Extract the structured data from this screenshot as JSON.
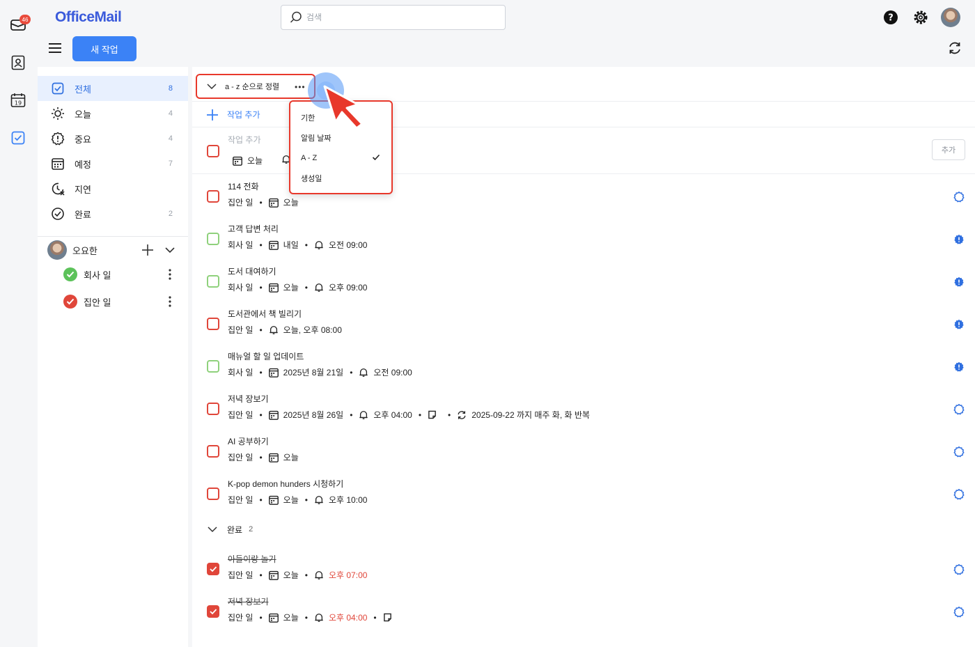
{
  "app": {
    "logo": "OfficeMail",
    "mail_badge": "46"
  },
  "search": {
    "placeholder": "검색"
  },
  "toolbar": {
    "new_task": "새 작업"
  },
  "sidebar": {
    "items": [
      {
        "label": "전체",
        "count": "8",
        "icon": "check-square-icon"
      },
      {
        "label": "오늘",
        "count": "4",
        "icon": "sun-icon"
      },
      {
        "label": "중요",
        "count": "4",
        "icon": "important-icon"
      },
      {
        "label": "예정",
        "count": "7",
        "icon": "calendar-icon"
      },
      {
        "label": "지연",
        "count": "",
        "icon": "overdue-clock-icon"
      },
      {
        "label": "완료",
        "count": "2",
        "icon": "check-circle-icon"
      }
    ],
    "group": {
      "name": "오요한"
    },
    "lists": [
      {
        "label": "회사 일",
        "color": "#5cc25a"
      },
      {
        "label": "집안 일",
        "color": "#e0463a"
      }
    ]
  },
  "sort": {
    "label": "a - z 순으로 정렬"
  },
  "sort_menu": {
    "items": [
      "기한",
      "알림 날짜",
      "A - Z",
      "생성일"
    ],
    "selected": "A - Z"
  },
  "add_task": {
    "label": "작업 추가"
  },
  "compose": {
    "placeholder": "작업 추가",
    "due": "오늘",
    "add_button": "추가"
  },
  "tasks": [
    {
      "title": "114 전화",
      "list": "집안 일",
      "due": "오늘",
      "remind": "",
      "extra": "",
      "color": "red",
      "star": "outline"
    },
    {
      "title": "고객 답변 처리",
      "list": "회사 일",
      "due": "내일",
      "remind": "오전 09:00",
      "extra": "",
      "color": "green",
      "star": "filled"
    },
    {
      "title": "도서 대여하기",
      "list": "회사 일",
      "due": "오늘",
      "remind": "오후 09:00",
      "extra": "",
      "color": "green",
      "star": "filled"
    },
    {
      "title": "도서관에서 책 빌리기",
      "list": "집안 일",
      "due": "",
      "remind": "오늘, 오후 08:00",
      "extra": "",
      "color": "red",
      "star": "filled"
    },
    {
      "title": "매뉴얼 할 일 업데이트",
      "list": "회사 일",
      "due": "2025년 8월 21일",
      "remind": "오전 09:00",
      "extra": "",
      "color": "green",
      "star": "filled"
    },
    {
      "title": "저녁 장보기",
      "list": "집안 일",
      "due": "2025년 8월 26일",
      "remind": "오후 04:00",
      "extra": "2025-09-22 까지 매주 화, 화 반복",
      "color": "red",
      "star": "outline"
    },
    {
      "title": "AI 공부하기",
      "list": "집안 일",
      "due": "오늘",
      "remind": "",
      "extra": "",
      "color": "red",
      "star": "outline"
    },
    {
      "title": "K-pop demon hunders 시청하기",
      "list": "집안 일",
      "due": "오늘",
      "remind": "오후 10:00",
      "extra": "",
      "color": "red",
      "star": "outline"
    }
  ],
  "completed": {
    "label": "완료",
    "count": "2",
    "tasks": [
      {
        "title": "아들이랑 놀기",
        "list": "집안 일",
        "due": "오늘",
        "remind": "오후 07:00"
      },
      {
        "title": "저녁 장보기",
        "list": "집안 일",
        "due": "오늘",
        "remind": "오후 04:00"
      }
    ]
  },
  "colors": {
    "accent": "#3b82f6",
    "brand": "#3b5bdb",
    "danger": "#e0463a",
    "success": "#5cc25a"
  }
}
